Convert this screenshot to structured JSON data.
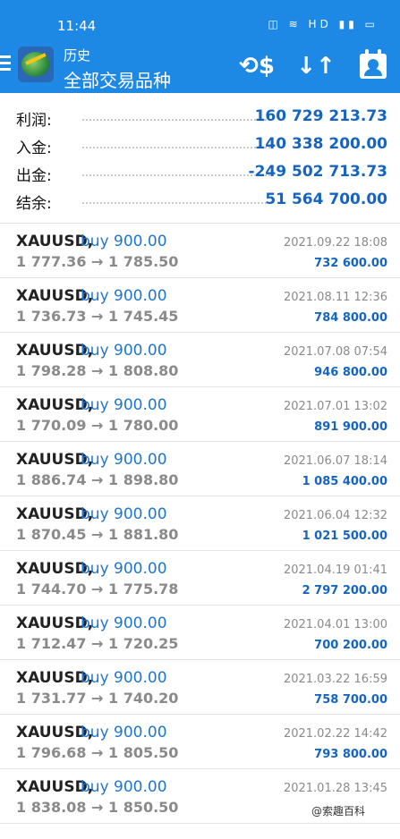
{
  "status_bar": {
    "time": "11:44",
    "indicators": "◫ ≋ HD ▮▮ ▭"
  },
  "header": {
    "subtitle": "历史",
    "title": "全部交易品种",
    "icons": [
      "menu-icon",
      "metatrader-logo",
      "currency-exchange-icon",
      "sort-icon",
      "calendar-user-icon"
    ],
    "accent": "#1e88e5"
  },
  "summary": [
    {
      "label": "利润:",
      "value": "160 729 213.73"
    },
    {
      "label": "入金:",
      "value": "140 338 200.00"
    },
    {
      "label": "出金:",
      "value": "-249 502 713.73"
    },
    {
      "label": "结余:",
      "value": "51 564 700.00"
    }
  ],
  "trades": [
    {
      "symbol": "XAUUSD,",
      "direction": "buy 900.00",
      "prices": "1 777.36 → 1 785.50",
      "date": "2021.09.22 18:08",
      "profit": "732 600.00"
    },
    {
      "symbol": "XAUUSD,",
      "direction": "buy 900.00",
      "prices": "1 736.73 → 1 745.45",
      "date": "2021.08.11 12:36",
      "profit": "784 800.00"
    },
    {
      "symbol": "XAUUSD,",
      "direction": "buy 900.00",
      "prices": "1 798.28 → 1 808.80",
      "date": "2021.07.08 07:54",
      "profit": "946 800.00"
    },
    {
      "symbol": "XAUUSD,",
      "direction": "buy 900.00",
      "prices": "1 770.09 → 1 780.00",
      "date": "2021.07.01 13:02",
      "profit": "891 900.00"
    },
    {
      "symbol": "XAUUSD,",
      "direction": "buy 900.00",
      "prices": "1 886.74 → 1 898.80",
      "date": "2021.06.07 18:14",
      "profit": "1 085 400.00"
    },
    {
      "symbol": "XAUUSD,",
      "direction": "buy 900.00",
      "prices": "1 870.45 → 1 881.80",
      "date": "2021.06.04 12:32",
      "profit": "1 021 500.00"
    },
    {
      "symbol": "XAUUSD,",
      "direction": "buy 900.00",
      "prices": "1 744.70 → 1 775.78",
      "date": "2021.04.19 01:41",
      "profit": "2 797 200.00"
    },
    {
      "symbol": "XAUUSD,",
      "direction": "buy 900.00",
      "prices": "1 712.47 → 1 720.25",
      "date": "2021.04.01 13:00",
      "profit": "700 200.00"
    },
    {
      "symbol": "XAUUSD,",
      "direction": "buy 900.00",
      "prices": "1 731.77 → 1 740.20",
      "date": "2021.03.22 16:59",
      "profit": "758 700.00"
    },
    {
      "symbol": "XAUUSD,",
      "direction": "buy 900.00",
      "prices": "1 796.68 → 1 805.50",
      "date": "2021.02.22 14:42",
      "profit": "793 800.00"
    },
    {
      "symbol": "XAUUSD,",
      "direction": "buy 900.00",
      "prices": "1 838.08 → 1 850.50",
      "date": "2021.01.28 13:45",
      "profit": ""
    }
  ],
  "watermark": "@索趣百科"
}
